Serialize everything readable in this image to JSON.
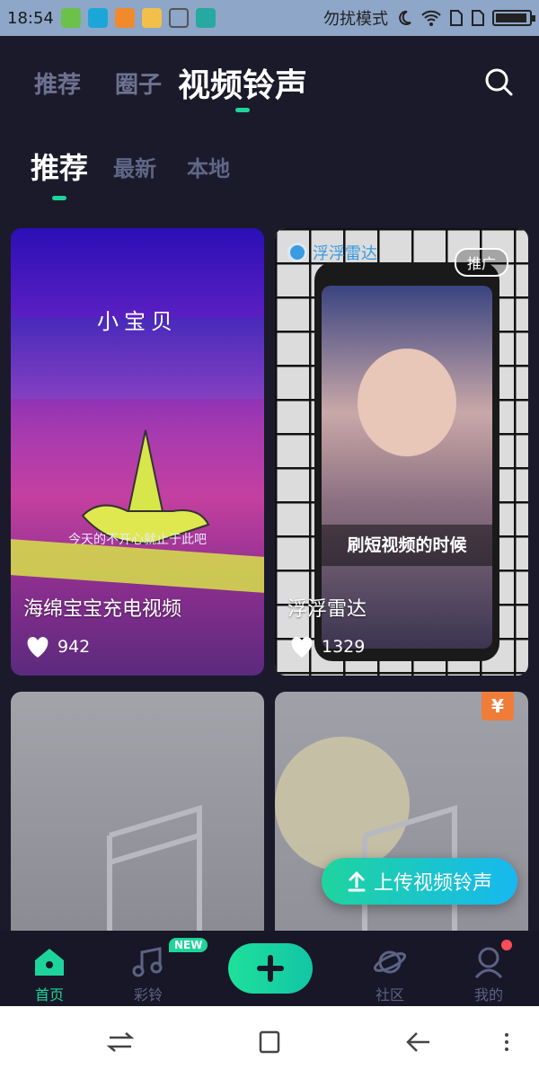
{
  "status": {
    "time": "18:54",
    "dnd_text": "勿扰模式",
    "battery_level": 0.95
  },
  "top_tabs": [
    {
      "label": "推荐",
      "active": false
    },
    {
      "label": "圈子",
      "active": false
    },
    {
      "label": "视频铃声",
      "active": true
    }
  ],
  "sub_tabs": [
    {
      "label": "推荐",
      "active": true
    },
    {
      "label": "最新",
      "active": false
    },
    {
      "label": "本地",
      "active": false
    }
  ],
  "cards": [
    {
      "title": "海绵宝宝充电视频",
      "likes": "942",
      "overlay_text": "小宝贝",
      "caption": "今天的不开心就止于此吧"
    },
    {
      "title": "浮浮雷达",
      "likes": "1329",
      "ad_label": "推广",
      "brand": "浮浮雷达",
      "overlay_text": "刷短视频的时候"
    },
    {
      "title": "",
      "likes": ""
    },
    {
      "title": "",
      "likes": "",
      "price_badge": "¥"
    }
  ],
  "upload_button": {
    "label": "上传视频铃声"
  },
  "bottom_nav": [
    {
      "label": "首页",
      "icon": "home-icon",
      "active": true
    },
    {
      "label": "彩铃",
      "icon": "music-note-icon",
      "active": false,
      "badge": "NEW"
    },
    {
      "label": "",
      "icon": "plus-icon",
      "active": false
    },
    {
      "label": "社区",
      "icon": "planet-icon",
      "active": false
    },
    {
      "label": "我的",
      "icon": "profile-icon",
      "active": false
    }
  ],
  "colors": {
    "accent": "#1ed49a",
    "background": "#1b1a2b",
    "inactive": "#5c6384"
  }
}
